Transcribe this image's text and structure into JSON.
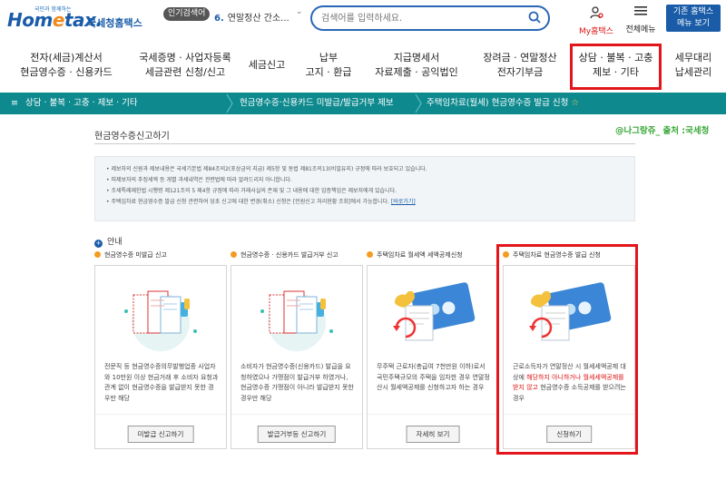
{
  "header": {
    "logo_sub": "국민과 함께하는",
    "logo_main_pre": "Hom",
    "logo_main_e": "e",
    "logo_main_post": "tax.",
    "logo_kr": "국세청홈택스",
    "hot_badge": "인기검색어",
    "hot_rank": "6.",
    "hot_term": "연말정산 간소...",
    "search_placeholder": "검색어를 입력하세요.",
    "my_label": "My홈택스",
    "allmenu_label": "전체메뉴",
    "classic_line1": "기존 홈택스",
    "classic_line2": "메뉴 보기"
  },
  "gnb": [
    {
      "line1": "전자(세금)계산서",
      "line2": "현금영수증 · 신용카드"
    },
    {
      "line1": "국세증명 · 사업자등록",
      "line2": "세금관련 신청/신고"
    },
    {
      "line1": "세금신고",
      "line2": ""
    },
    {
      "line1": "납부",
      "line2": "고지 · 환급"
    },
    {
      "line1": "지급명세서",
      "line2": "자료제출 · 공익법인"
    },
    {
      "line1": "장려금 · 연말정산",
      "line2": "전자기부금"
    },
    {
      "line1": "상담 · 불복 · 고충",
      "line2": "제보 · 기타"
    },
    {
      "line1": "세무대리",
      "line2": "납세관리"
    }
  ],
  "breadcrumb": {
    "menu_icon": "≡",
    "level1": "상담 · 불복 · 고충 · 제보 · 기타",
    "level2": "현금영수증·신용카드 미발급/발급거부 제보",
    "level3": "주택임차료(월세) 현금영수증 발급 신청",
    "star": "☆"
  },
  "page_title": "현금영수증신고하기",
  "credit": "@나그랑쥬_ 출처 :국세청",
  "notices": [
    "제보자의 신원과 제보내용은 국세기본법 제84조의2(포상금의 지급) 제5항 및 동법 제81조의13(비밀유지) 규정에 따라 보호되고 있습니다.",
    "피제보자의 추징세액 등 개별 과세내역은 관련법에 따라 알려드리지 아니합니다.",
    "조세특례제한법 시행령 제121조의 5 제4항 규정에 따라 거래사실의 존재 및 그 내용에 대한 입증책임은 제보자에게 있습니다.",
    "주택임차료 현금영수증 발급 신청 관련하여 당초 신고에 대한 변경(취소) 신청은 [민원신고 처리현황 조회]에서 가능합니다."
  ],
  "notice_link": "[바로가기]",
  "guide_label": "안내",
  "cards": [
    {
      "title": "현금영수증 미발급 신고",
      "desc": "전문직 등 현금영수증의무발행업종 사업자와 10만원 이상 현금거래 후 소비자 요청과 관계 없이 현금영수증을 발급받지 못한 경우만 해당",
      "button": "미발급 신고하기"
    },
    {
      "title": "현금영수증 · 신용카드 발급거부 신고",
      "desc": "소비자가 현금영수증(신용카드) 발급을 요청하였으나 가맹점이 발급거부 하였거나, 현금영수증 가맹점이 아니라 발급받지 못한 경우만 해당",
      "button": "발급거부등 신고하기"
    },
    {
      "title": "주택임차료 월세액 세액공제신청",
      "desc": "무주택 근로자(총급여 7천만원 이하)로서 국민주택규모의 주택을 임차한 경우 연말정산시 월세액공제를 신청하고자 하는 경우",
      "button": "자세히 보기"
    },
    {
      "title": "주택임차료 현금영수증 발급 신청",
      "desc_pre": "근로소득자가 연말정산 시 월세세액공제 대상에 ",
      "desc_red": "해당하지 아니하거나 월세세액공제를 받지 않고",
      "desc_post": " 현금영수증 소득공제를 받으려는 경우",
      "button": "신청하기"
    }
  ],
  "colors": {
    "brand_blue": "#1a5ca8",
    "teal_bar": "#0e8a8f",
    "highlight_red": "#e3151b",
    "credit_green": "#3aa83a"
  }
}
